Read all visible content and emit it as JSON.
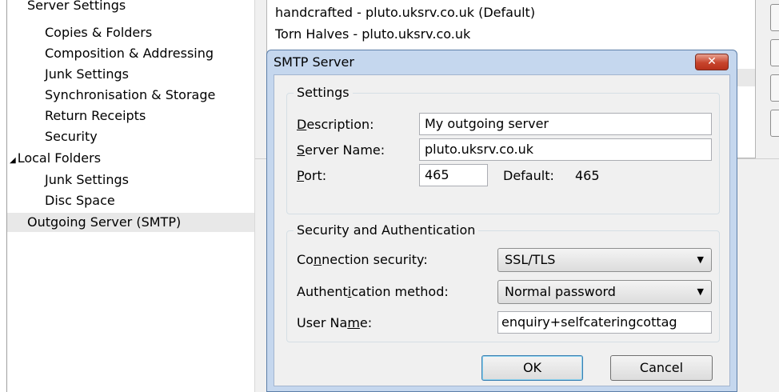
{
  "tree": {
    "items": [
      {
        "label": "Server Settings"
      },
      {
        "label": "Copies & Folders"
      },
      {
        "label": "Composition & Addressing"
      },
      {
        "label": "Junk Settings"
      },
      {
        "label": "Synchronisation & Storage"
      },
      {
        "label": "Return Receipts"
      },
      {
        "label": "Security"
      },
      {
        "label": "Local Folders"
      },
      {
        "label": "Junk Settings"
      },
      {
        "label": "Disc Space"
      },
      {
        "label": "Outgoing Server (SMTP)"
      }
    ],
    "collapse_arrow": "◢"
  },
  "server_list": {
    "rows": [
      {
        "label": "handcrafted - pluto.uksrv.co.uk (Default)"
      },
      {
        "label": "Torn Halves - pluto.uksrv.co.uk"
      }
    ]
  },
  "dialog": {
    "title": "SMTP Server",
    "close_glyph": "✕",
    "settings": {
      "legend": "Settings",
      "description_label_key": "D",
      "description_label_rest": "escription:",
      "description_value": "My outgoing server",
      "server_name_label_key": "S",
      "server_name_label_rest": "erver Name:",
      "server_name_value": "pluto.uksrv.co.uk",
      "port_label_key": "P",
      "port_label_rest": "ort:",
      "port_value": "465",
      "default_label": "Default:",
      "default_value": "465"
    },
    "security": {
      "legend": "Security and Authentication",
      "connection_label_pre": "Co",
      "connection_label_key": "n",
      "connection_label_post": "nection security:",
      "connection_value": "SSL/TLS",
      "auth_label_pre": "Authent",
      "auth_label_key": "i",
      "auth_label_post": "cation method:",
      "auth_value": "Normal password",
      "username_label_pre": "User Na",
      "username_label_key": "m",
      "username_label_post": "e:",
      "username_value": "enquiry+selfcateringcottag"
    },
    "ok_label": "OK",
    "cancel_label": "Cancel",
    "dropdown_glyph": "▼"
  }
}
